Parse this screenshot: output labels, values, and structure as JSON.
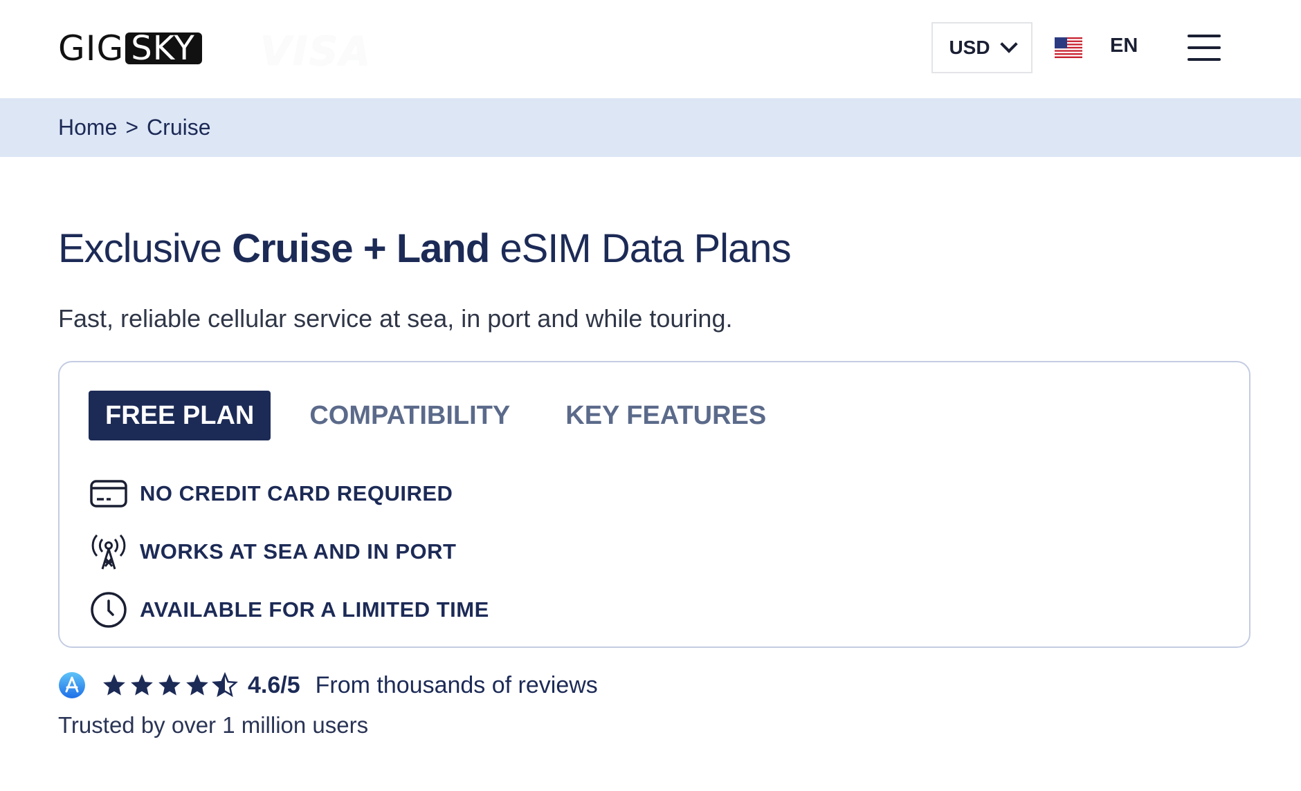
{
  "header": {
    "logo_left": "GIG",
    "logo_right": "SKY",
    "partner_logo": "VISA",
    "currency": "USD",
    "language": "EN",
    "icons": [
      "chevron-down-icon",
      "us-flag-icon",
      "hamburger-menu-icon"
    ]
  },
  "breadcrumb": {
    "home": "Home",
    "separator": ">",
    "current": "Cruise"
  },
  "hero": {
    "title_pre": "Exclusive ",
    "title_bold": "Cruise + Land",
    "title_post": " eSIM Data Plans",
    "subtitle": "Fast, reliable cellular service at sea, in port and while touring."
  },
  "tabs": [
    {
      "label": "FREE PLAN",
      "active": true
    },
    {
      "label": "COMPATIBILITY",
      "active": false
    },
    {
      "label": "KEY FEATURES",
      "active": false
    }
  ],
  "features": [
    {
      "icon": "credit-card-icon",
      "label": "NO CREDIT CARD REQUIRED"
    },
    {
      "icon": "antenna-tower-icon",
      "label": "WORKS AT SEA AND IN PORT"
    },
    {
      "icon": "clock-icon",
      "label": "AVAILABLE FOR A LIMITED TIME"
    }
  ],
  "rating": {
    "source_icon": "app-store-icon",
    "stars": 4.6,
    "score": "4.6/5",
    "text": "From thousands of reviews",
    "trusted": "Trusted by over 1 million users"
  },
  "colors": {
    "navy": "#1c2a56",
    "breadcrumb_bg": "#dde6f5",
    "card_border": "#c3cce2",
    "tab_inactive": "#5b6a8a"
  }
}
